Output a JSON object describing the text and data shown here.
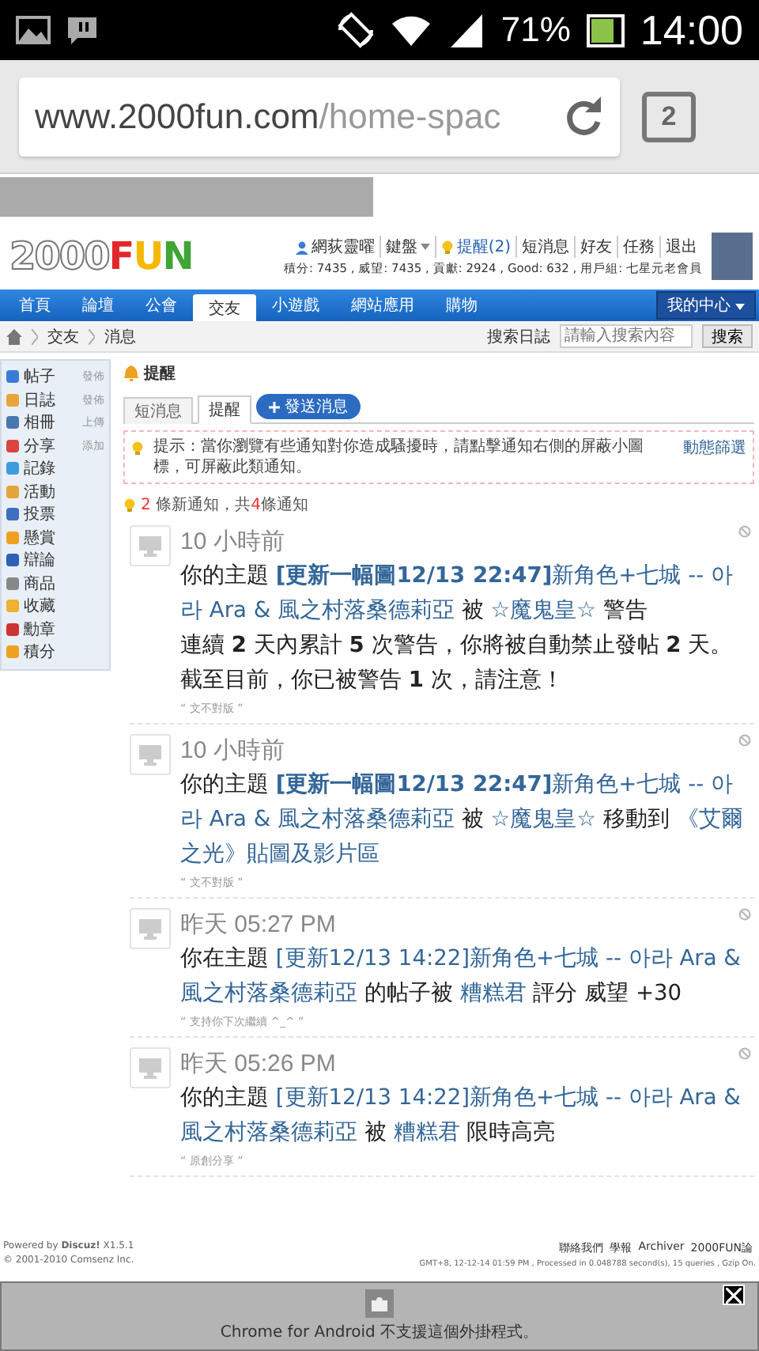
{
  "status_bar": {
    "battery": "71%",
    "time": "14:00"
  },
  "browser": {
    "url_host": "www.2000fun.com",
    "url_path": "/home-spac",
    "tab_count": "2"
  },
  "header": {
    "logo_number": "2000",
    "logo_word": "FUN",
    "user_links": [
      {
        "label": "網荻靈曜",
        "kind": "user"
      },
      {
        "label": "鍵盤",
        "kind": "menu"
      },
      {
        "label": "提醒(2)",
        "kind": "alert"
      },
      {
        "label": "短消息",
        "kind": "plain"
      },
      {
        "label": "好友",
        "kind": "plain"
      },
      {
        "label": "任務",
        "kind": "plain"
      },
      {
        "label": "退出",
        "kind": "plain"
      }
    ],
    "stats": "積分: 7435 , 威望: 7435 , 貢獻: 2924 , Good: 632 , 用戶組: 七星元老會員"
  },
  "nav": {
    "items": [
      {
        "label": "首頁",
        "selected": false
      },
      {
        "label": "論壇",
        "selected": false
      },
      {
        "label": "公會",
        "selected": false
      },
      {
        "label": "交友",
        "selected": true
      },
      {
        "label": "小遊戲",
        "selected": false
      },
      {
        "label": "網站應用",
        "selected": false
      },
      {
        "label": "購物",
        "selected": false
      }
    ],
    "my_center": "我的中心"
  },
  "breadcrumb": {
    "items": [
      "交友",
      "消息"
    ],
    "search_scope": "搜索日誌",
    "search_placeholder": "請輸入搜索內容",
    "search_button": "搜索"
  },
  "sidebar": {
    "items": [
      {
        "label": "帖子",
        "action": "發佈"
      },
      {
        "label": "日誌",
        "action": "發佈"
      },
      {
        "label": "相冊",
        "action": "上傳"
      },
      {
        "label": "分享",
        "action": "添加"
      },
      {
        "label": "記錄"
      },
      {
        "label": "活動"
      },
      {
        "label": "投票"
      },
      {
        "label": "懸賞"
      },
      {
        "label": "辯論"
      },
      {
        "label": "商品"
      },
      {
        "label": "收藏"
      },
      {
        "label": "勳章"
      },
      {
        "label": "積分"
      }
    ]
  },
  "main": {
    "title": "提醒",
    "tabs": [
      {
        "label": "短消息",
        "selected": false
      },
      {
        "label": "提醒",
        "selected": true
      }
    ],
    "send_button": "發送消息",
    "tip": {
      "text": "提示：當你瀏覽有些通知對你造成騷擾時，請點擊通知右側的屏蔽小圖標，可屏蔽此類通知。",
      "link": "動態篩選"
    },
    "summary": {
      "new_count": "2",
      "middle": "條新通知，共",
      "total": "4",
      "end": "條通知"
    },
    "notifications": [
      {
        "time": "10 小時前",
        "quote": "“ 文不對版 ”",
        "segments": [
          {
            "kind": "text",
            "text": "你的主題 "
          },
          {
            "kind": "link",
            "text": "**[更新一幅圖12/13 22:47]**新角色+七城 -- 아라 Ara & 風之村落桑德莉亞"
          },
          {
            "kind": "text",
            "text": " 被 "
          },
          {
            "kind": "link",
            "text": "☆魔鬼皇☆"
          },
          {
            "kind": "text",
            "text": " 警告"
          },
          {
            "kind": "break"
          },
          {
            "kind": "text",
            "text": "連續 **2** 天內累計 **5** 次警告，你將被自動禁止發帖 **2** 天。"
          },
          {
            "kind": "break"
          },
          {
            "kind": "text",
            "text": "截至目前，你已被警告 **1** 次，請注意！"
          }
        ]
      },
      {
        "time": "10 小時前",
        "quote": "“ 文不對版 ”",
        "segments": [
          {
            "kind": "text",
            "text": "你的主題 "
          },
          {
            "kind": "link",
            "text": "**[更新一幅圖12/13 22:47]**新角色+七城 -- 아라 Ara & 風之村落桑德莉亞"
          },
          {
            "kind": "text",
            "text": " 被 "
          },
          {
            "kind": "link",
            "text": "☆魔鬼皇☆"
          },
          {
            "kind": "text",
            "text": " 移動到 "
          },
          {
            "kind": "link",
            "text": "《艾爾之光》貼圖及影片區"
          }
        ]
      },
      {
        "time": "昨天 05:27 PM",
        "quote": "“ 支持你下次繼續 ^_^ ”",
        "segments": [
          {
            "kind": "text",
            "text": "你在主題 "
          },
          {
            "kind": "link",
            "text": "[更新12/13 14:22]新角色+七城 -- 아라 Ara & 風之村落桑德莉亞"
          },
          {
            "kind": "text",
            "text": " 的帖子被 "
          },
          {
            "kind": "link",
            "text": "糟糕君"
          },
          {
            "kind": "text",
            "text": " 評分 威望 +30"
          }
        ]
      },
      {
        "time": "昨天 05:26 PM",
        "quote": "“ 原創分享 ”",
        "segments": [
          {
            "kind": "text",
            "text": "你的主題 "
          },
          {
            "kind": "link",
            "text": "[更新12/13 14:22]新角色+七城 -- 아라 Ara & 風之村落桑德莉亞"
          },
          {
            "kind": "text",
            "text": " 被 "
          },
          {
            "kind": "link",
            "text": "糟糕君"
          },
          {
            "kind": "text",
            "text": " 限時高亮"
          }
        ]
      }
    ]
  },
  "footer": {
    "powered": "Powered by **Discuz!** X1.5.1",
    "copyright": "© 2001-2010 Comsenz Inc.",
    "links": [
      "聯絡我們",
      "學報",
      "Archiver",
      "2000FUN論"
    ],
    "stats": "GMT+8, 12-12-14 01:59 PM , Processed in 0.048788 second(s), 15 queries , Gzip On."
  },
  "plugin": {
    "message": "Chrome for Android 不支援這個外掛程式。"
  }
}
